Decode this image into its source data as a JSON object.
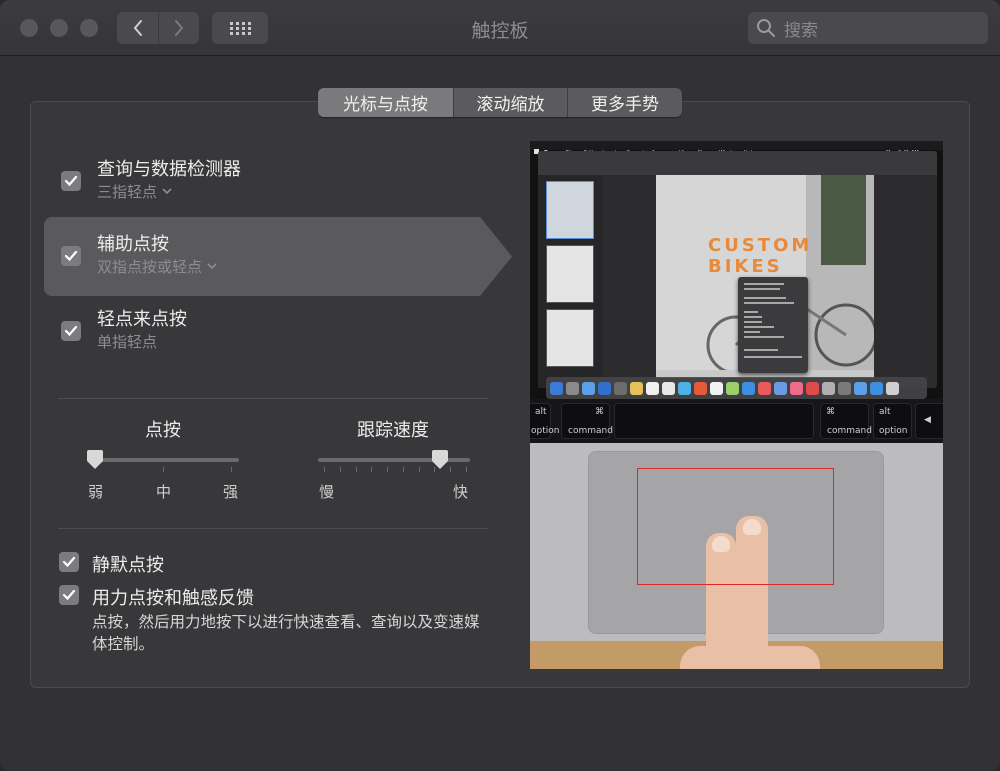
{
  "window": {
    "title": "触控板",
    "search_placeholder": "搜索"
  },
  "tabs": [
    {
      "label": "光标与点按",
      "active": true
    },
    {
      "label": "滚动缩放",
      "active": false
    },
    {
      "label": "更多手势",
      "active": false
    }
  ],
  "options": [
    {
      "title": "查询与数据检测器",
      "subtitle": "三指轻点",
      "checked": true,
      "has_dropdown": true,
      "selected": false
    },
    {
      "title": "辅助点按",
      "subtitle": "双指点按或轻点",
      "checked": true,
      "has_dropdown": true,
      "selected": true
    },
    {
      "title": "轻点来点按",
      "subtitle": "单指轻点",
      "checked": true,
      "has_dropdown": false,
      "selected": false
    }
  ],
  "sliders": {
    "click": {
      "title": "点按",
      "labels": [
        "弱",
        "中",
        "强"
      ],
      "value_index": 0,
      "steps": 3
    },
    "tracking": {
      "title": "跟踪速度",
      "labels": [
        "慢",
        "快"
      ],
      "value": 0.8,
      "ticks": 10
    }
  },
  "bottom_options": [
    {
      "title": "静默点按",
      "checked": true
    },
    {
      "title": "用力点按和触感反馈",
      "checked": true,
      "description": "点按，然后用力地按下以进行快速查看、查询以及变速媒体控制。"
    }
  ],
  "preview": {
    "menubar": [
      "Pages",
      "File",
      "Edit",
      "Insert",
      "Format",
      "Arrange",
      "View",
      "Share",
      "Window",
      "Help"
    ],
    "clock": "Mon 9:41 AM",
    "doc_title": "CUSTOM BIKES",
    "context_menu": [
      "Bring to Front",
      "Send to Back",
      "Align Objects",
      "Distribute Objects",
      "Cut",
      "Copy",
      "Paste",
      "Duplicate",
      "Lock",
      "Make Editable",
      "Import Image",
      "Capture Selection from Screen"
    ],
    "keys": {
      "alt": "alt",
      "option": "option",
      "command": "command",
      "cmd_symbol": "⌘"
    },
    "highlight_color": "#e0262b"
  },
  "colors": {
    "window_bg": "#323234",
    "panel_bg": "#38383a",
    "selected_row": "#5a5a5c",
    "checkbox": "#7c7c7e"
  }
}
